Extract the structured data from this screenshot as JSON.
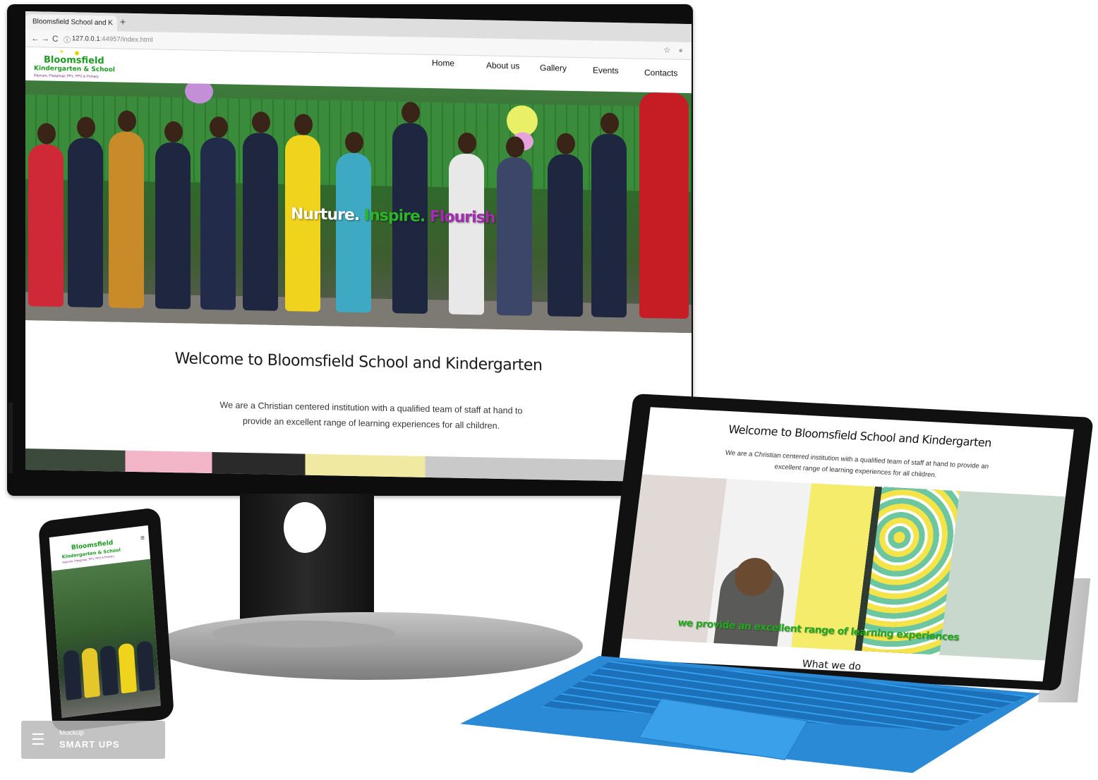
{
  "browser": {
    "tab_title": "Bloomsfield School and K",
    "tab_add": "+",
    "back": "←",
    "forward": "→",
    "reload": "C",
    "info": "ⓘ",
    "url_host": "127.0.0.1",
    "url_rest": ":44957/index.html",
    "bookmark": "☆",
    "account": "●"
  },
  "site": {
    "logo_line1": "Bloomsfield",
    "logo_line2": "Kindergarten & School",
    "logo_line3": "Daycare, Playgroup, PP1, PP2 & Primary",
    "nav": [
      "Home",
      "About us",
      "Gallery",
      "Events",
      "Contacts"
    ],
    "tagline": [
      "Nurture",
      "Inspire",
      "Flourish"
    ],
    "tagline_sep": ".",
    "welcome_title": "Welcome to Bloomsfield School and Kindergarten",
    "welcome_text": "We are a Christian centered institution with a qualified team of staff at hand to provide an excellent range of learning experiences for all children."
  },
  "tablet": {
    "title": "Welcome to Bloomsfield School and Kindergarten",
    "text": "We are a Christian centered institution with a qualified team of staff at hand to provide an excellent range of learning experiences for all children.",
    "hero_tagline": "we provide an excellent range of learning experiences",
    "section_heading": "What we do"
  },
  "phone": {
    "logo_line1": "Bloomsfield",
    "logo_line2": "Kindergarten & School",
    "logo_line3": "Daycare, Playgroup, PP1, PP2 & Primary",
    "menu_icon": "≡"
  },
  "watermark": {
    "line1": "Mockup",
    "line2": "SMART",
    "line3": "UPS"
  },
  "colors": {
    "brand_green": "#1e9a22",
    "tagline_white": "#ffffff",
    "tagline_green": "#2db52a",
    "tagline_purple": "#a42ab2",
    "keyboard_blue": "#2a8ad6"
  },
  "icons": [
    "back-arrow-icon",
    "forward-arrow-icon",
    "reload-icon",
    "info-icon",
    "bookmark-star-icon",
    "account-icon",
    "hamburger-menu-icon",
    "layers-icon"
  ]
}
